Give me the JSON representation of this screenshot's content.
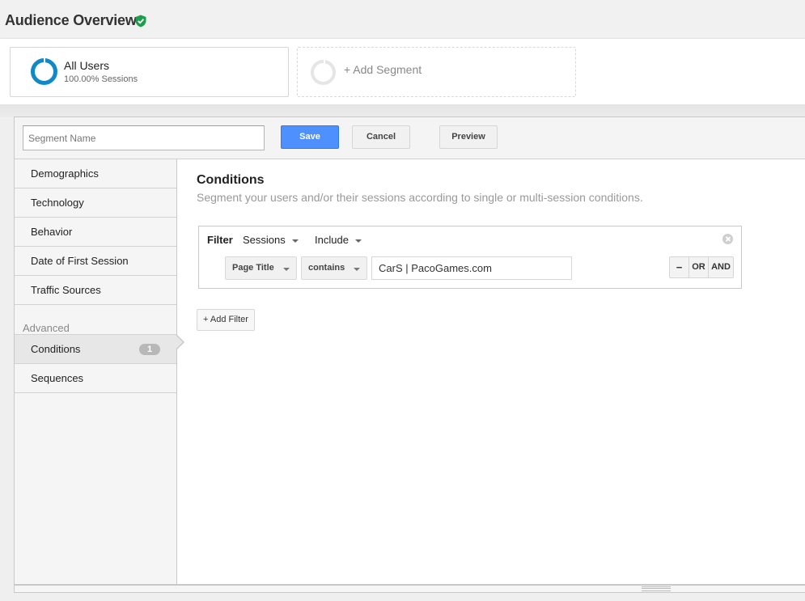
{
  "header": {
    "title": "Audience Overview",
    "verified_icon": "shield-check-icon",
    "verified_color": "#1e9e4c"
  },
  "segments": {
    "active": {
      "name": "All Users",
      "subtitle": "100.00% Sessions",
      "ring_color": "#0f8ac6"
    },
    "add_label": "+ Add Segment"
  },
  "toolbar": {
    "name_placeholder": "Segment Name",
    "name_value": "",
    "save_label": "Save",
    "cancel_label": "Cancel",
    "preview_label": "Preview",
    "save_color": "#4d90fe"
  },
  "sidebar": {
    "items": [
      {
        "label": "Demographics"
      },
      {
        "label": "Technology"
      },
      {
        "label": "Behavior"
      },
      {
        "label": "Date of First Session"
      },
      {
        "label": "Traffic Sources"
      }
    ],
    "advanced_heading": "Advanced",
    "advanced_items": [
      {
        "label": "Conditions",
        "badge": "1",
        "active": true
      },
      {
        "label": "Sequences"
      }
    ]
  },
  "conditions": {
    "title": "Conditions",
    "description": "Segment your users and/or their sessions according to single or multi-session conditions.",
    "filter": {
      "label": "Filter",
      "scope": "Sessions",
      "mode": "Include",
      "dimension": "Page Title",
      "operator": "contains",
      "value": "CarS | PacoGames.com",
      "logic_buttons": {
        "remove": "−",
        "or": "OR",
        "and": "AND"
      }
    },
    "add_filter_label": "+ Add Filter"
  }
}
